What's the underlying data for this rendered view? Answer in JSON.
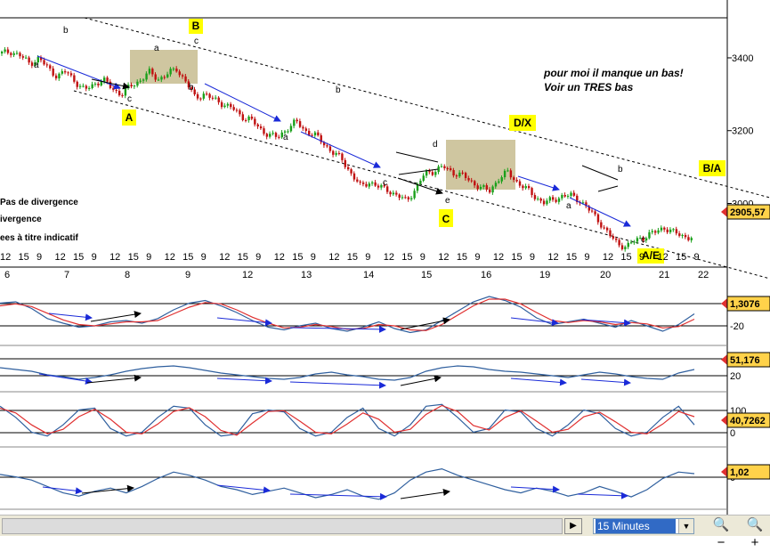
{
  "chart_data": [
    {
      "type": "candlestick",
      "yticks": [
        "3400",
        "3200",
        "3000"
      ],
      "ytick_values": [
        3400,
        3200,
        3000
      ],
      "ylim": [
        2830,
        3510
      ],
      "last_value_label": "2905,57",
      "last_value": 2905.57,
      "xticks_hours": [
        "12",
        "15",
        "9",
        "12",
        "15",
        "9",
        "12",
        "15",
        "9",
        "12",
        "15",
        "9",
        "12",
        "15",
        "9",
        "12",
        "15",
        "9",
        "12",
        "15",
        "9",
        "12",
        "15",
        "9",
        "12",
        "15",
        "9",
        "12",
        "15",
        "9",
        "12",
        "15",
        "9",
        "12",
        "15",
        "9",
        "12",
        "15",
        "9"
      ],
      "xticks_days": [
        "6",
        "7",
        "8",
        "9",
        "12",
        "13",
        "14",
        "15",
        "16",
        "19",
        "20",
        "21",
        "22"
      ],
      "wave_letters": [
        "a",
        "b",
        "c",
        "a",
        "b",
        "c",
        "a",
        "b",
        "c",
        "d",
        "e",
        "a",
        "b",
        "c"
      ],
      "wave_boxes": [
        "A",
        "B",
        "C",
        "D/X",
        "B/A",
        "A/E"
      ],
      "notes": [
        "pour moi il manque un bas!",
        "Voir un TRES bas"
      ],
      "legend": [
        "Pas de divergence",
        "ivergence",
        "ees à titre indicatif"
      ],
      "price_path": [
        3412,
        3418,
        3405,
        3385,
        3398,
        3372,
        3350,
        3362,
        3335,
        3310,
        3328,
        3340,
        3315,
        3300,
        3322,
        3338,
        3360,
        3342,
        3355,
        3370,
        3335,
        3290,
        3302,
        3285,
        3275,
        3262,
        3240,
        3232,
        3205,
        3190,
        3180,
        3206,
        3224,
        3200,
        3188,
        3165,
        3140,
        3120,
        3082,
        3046,
        3060,
        3044,
        3038,
        3020,
        3008,
        3040,
        3082,
        3090,
        3100,
        3086,
        3078,
        3060,
        3045,
        3032,
        3068,
        3085,
        3060,
        3040,
        3018,
        3002,
        3010,
        3022,
        3020,
        3006,
        2978,
        2950,
        2915,
        2888,
        2882,
        2900,
        2910,
        2920,
        2935,
        2920,
        2912,
        2905
      ]
    },
    {
      "type": "line",
      "name": "indicator-1",
      "yticks": [
        "20",
        "-20"
      ],
      "ylim": [
        -40,
        40
      ],
      "last_value_label": "1,3076",
      "series": [
        {
          "color": "#2f5f9e",
          "values": [
            18,
            20,
            10,
            -5,
            -12,
            -18,
            -16,
            -10,
            -8,
            -12,
            -5,
            8,
            18,
            22,
            14,
            4,
            -8,
            -18,
            -22,
            -16,
            -12,
            -20,
            -24,
            -18,
            -10,
            -20,
            -26,
            -22,
            -8,
            6,
            20,
            28,
            22,
            12,
            -4,
            -14,
            -10,
            -6,
            -12,
            -18,
            -8,
            -16,
            -24,
            -14,
            2
          ]
        },
        {
          "color": "#e03030",
          "values": [
            14,
            17,
            13,
            3,
            -7,
            -14,
            -16,
            -13,
            -10,
            -10,
            -8,
            2,
            12,
            19,
            17,
            8,
            -3,
            -12,
            -19,
            -18,
            -14,
            -17,
            -21,
            -20,
            -14,
            -16,
            -22,
            -23,
            -14,
            0,
            14,
            24,
            24,
            17,
            4,
            -8,
            -11,
            -8,
            -10,
            -14,
            -11,
            -13,
            -19,
            -17,
            -6
          ]
        }
      ]
    },
    {
      "type": "line",
      "name": "indicator-2",
      "yticks": [
        "40",
        "20"
      ],
      "ylim": [
        10,
        90
      ],
      "last_value_label": "51,176",
      "series": [
        {
          "color": "#2f5f9e",
          "values": [
            56,
            52,
            48,
            40,
            36,
            30,
            34,
            40,
            48,
            54,
            58,
            60,
            56,
            50,
            44,
            40,
            36,
            32,
            30,
            34,
            42,
            46,
            40,
            36,
            30,
            28,
            34,
            48,
            56,
            60,
            58,
            52,
            48,
            46,
            42,
            38,
            34,
            40,
            46,
            42,
            36,
            32,
            30,
            44,
            52
          ]
        }
      ]
    },
    {
      "type": "line",
      "name": "indicator-3",
      "yticks": [
        "100",
        "0"
      ],
      "ylim": [
        -10,
        110
      ],
      "last_value_label": "40,7262",
      "series": [
        {
          "color": "#2f5f9e",
          "values": [
            90,
            60,
            20,
            10,
            40,
            80,
            85,
            30,
            10,
            20,
            60,
            90,
            85,
            40,
            10,
            15,
            70,
            80,
            75,
            30,
            10,
            20,
            60,
            85,
            30,
            10,
            40,
            90,
            95,
            60,
            20,
            30,
            80,
            75,
            30,
            10,
            40,
            80,
            70,
            30,
            10,
            20,
            60,
            90,
            40
          ]
        },
        {
          "color": "#e03030",
          "values": [
            85,
            72,
            40,
            16,
            28,
            62,
            82,
            55,
            20,
            16,
            42,
            76,
            86,
            62,
            25,
            12,
            45,
            76,
            78,
            50,
            20,
            16,
            42,
            72,
            55,
            20,
            28,
            68,
            92,
            76,
            38,
            26,
            60,
            78,
            50,
            20,
            28,
            62,
            74,
            48,
            20,
            16,
            42,
            76,
            62
          ]
        }
      ]
    },
    {
      "type": "line",
      "name": "indicator-4",
      "yticks": [
        "0"
      ],
      "ylim": [
        -3,
        3
      ],
      "last_value_label": "1,02",
      "series": [
        {
          "color": "#2f5f9e",
          "values": [
            0.9,
            0.6,
            0.2,
            -0.6,
            -1.4,
            -1.8,
            -1.2,
            -0.8,
            -1.4,
            -0.6,
            0.4,
            1.2,
            0.8,
            0.2,
            -0.6,
            -1.0,
            -1.6,
            -1.2,
            -0.8,
            -1.4,
            -2.0,
            -1.6,
            -1.0,
            -1.8,
            -2.2,
            -1.4,
            0.2,
            1.2,
            1.6,
            0.8,
            0.2,
            -0.4,
            -1.0,
            -1.4,
            -0.8,
            -1.2,
            -1.8,
            -1.4,
            -0.6,
            -1.2,
            -1.9,
            -1.0,
            0.4,
            1.2,
            1.0
          ]
        }
      ]
    }
  ],
  "toolbar": {
    "timeframe_label": "15 Minutes",
    "scroll_right_icon": "play-triangle-icon",
    "zoom_out_icon": "magnifier-minus-icon",
    "zoom_in_icon": "magnifier-plus-icon"
  },
  "colors": {
    "candle_up": "#1aa01a",
    "candle_down": "#c01010",
    "label_box": "#ffff00",
    "accumulation_box": "#cfc6a0",
    "arrow_blue": "#1a2ad8",
    "arrow_black": "#000000"
  }
}
